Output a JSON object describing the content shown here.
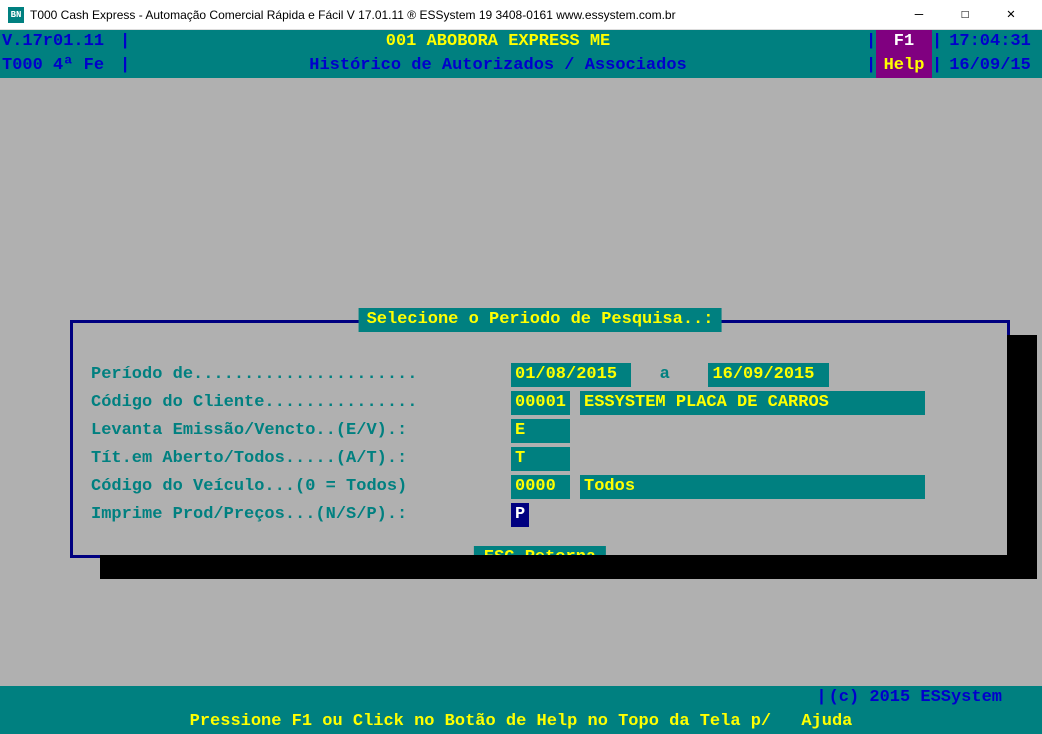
{
  "window": {
    "icon_text": "BN",
    "title": "T000 Cash Express - Automação Comercial Rápida e Fácil V 17.01.11   ® ESSystem   19 3408-0161   www.essystem.com.br"
  },
  "header": {
    "version": "V.17r01.11",
    "title_main": "001 ABOBORA EXPRESS ME",
    "help_key": "F1",
    "time": "17:04:31",
    "terminal": "T000 4ª Fe",
    "subtitle": "Histórico de Autorizados / Associados",
    "help_label": "Help",
    "date": "16/09/15"
  },
  "dialog": {
    "title": "Selecione o Periodo de Pesquisa..:",
    "footer": "ESC Retorna",
    "labels": {
      "periodo": "Período de......................",
      "periodo_sep": "a",
      "cliente": "Código do Cliente...............",
      "emissao": "Levanta Emissão/Vencto..(E/V).:",
      "aberto": "Tít.em Aberto/Todos.....(A/T).:",
      "veiculo": "Código do Veículo...(0 = Todos)",
      "imprime": "Imprime Prod/Preços...(N/S/P).:"
    },
    "values": {
      "date_from": "01/08/2015 ",
      "date_to": "16/09/2015 ",
      "cliente_code": "00001",
      "cliente_desc": "ESSYSTEM PLACA DE CARROS         ",
      "emissao": "E    ",
      "aberto": "T    ",
      "veiculo_code": "0000 ",
      "veiculo_desc": "Todos                            ",
      "imprime": "P"
    }
  },
  "footer": {
    "copyright": "(c) 2015 ESSystem",
    "help_text": "Pressione F1 ou Click no Botão de Help no Topo da Tela p/",
    "ajuda": "Ajuda"
  }
}
